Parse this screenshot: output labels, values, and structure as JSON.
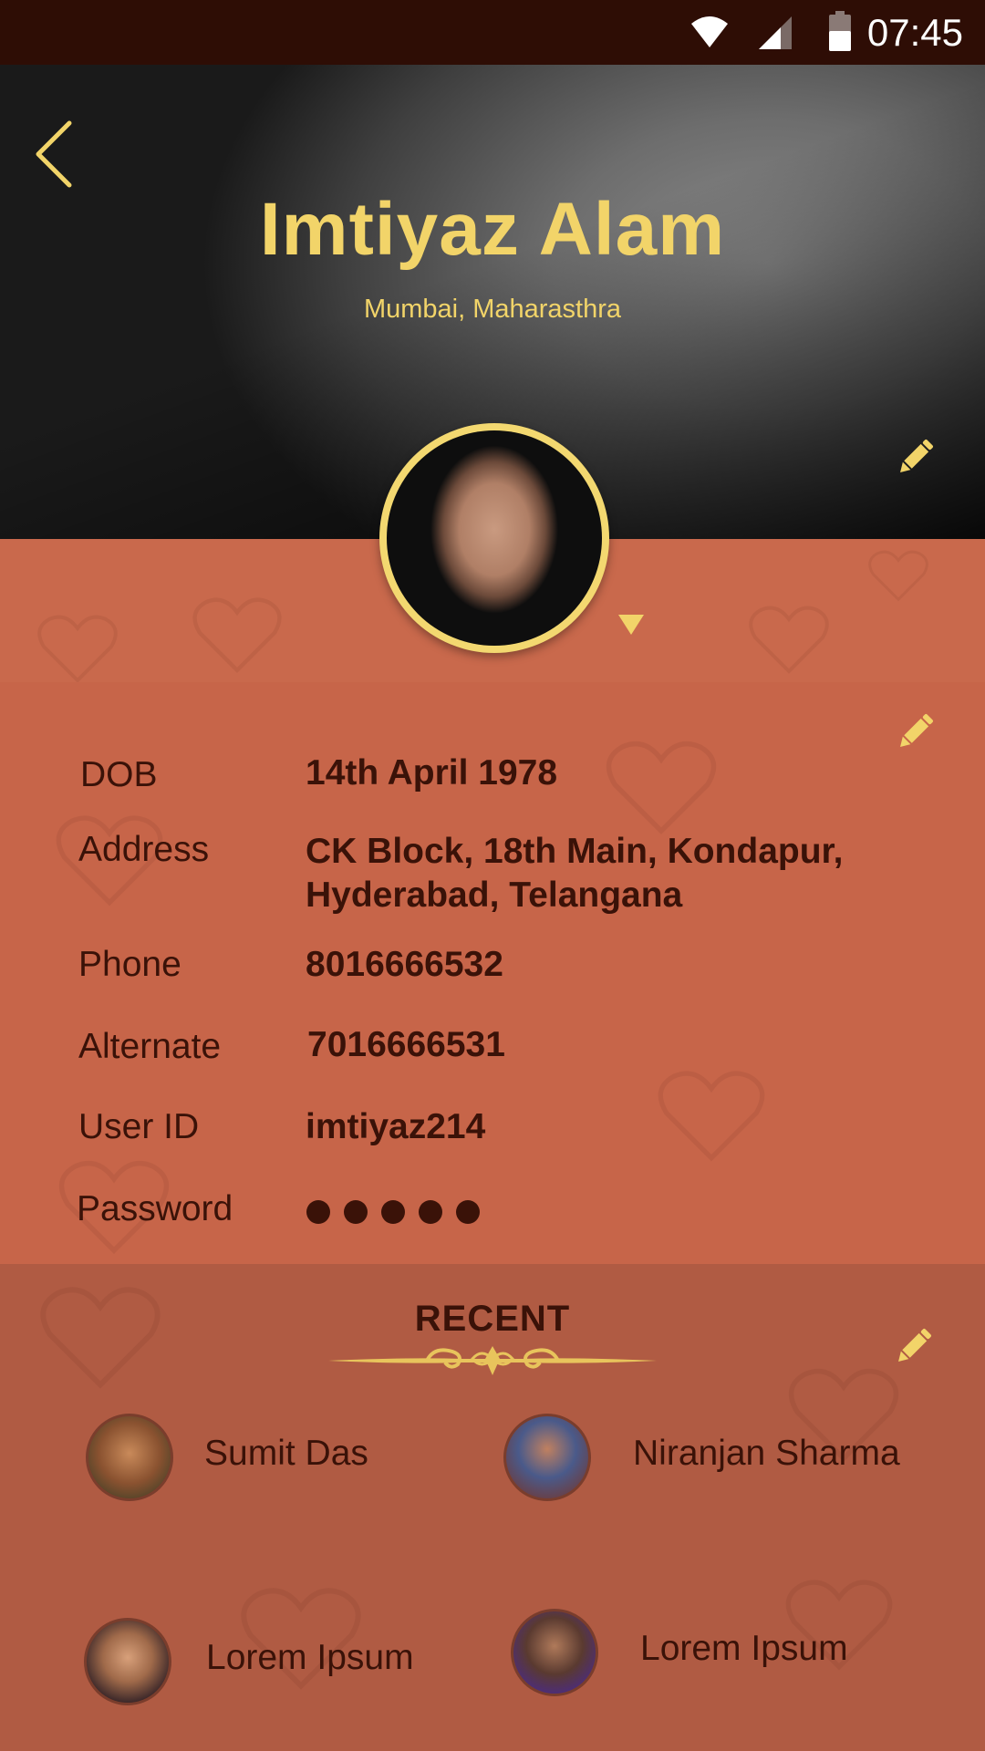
{
  "status_bar": {
    "time": "07:45",
    "icons": [
      "wifi-icon",
      "signal-icon",
      "battery-icon"
    ]
  },
  "profile": {
    "name": "Imtiyaz Alam",
    "location": "Mumbai, Maharasthra"
  },
  "details": {
    "rows": [
      {
        "label": "DOB",
        "value": "14th April 1978"
      },
      {
        "label": "Address",
        "value": "CK Block, 18th Main, Kondapur,",
        "value_line2": "Hyderabad, Telangana"
      },
      {
        "label": "Phone",
        "value": "8016666532"
      },
      {
        "label": "Alternate",
        "value": "7016666531"
      },
      {
        "label": "User ID",
        "value": "imtiyaz214"
      },
      {
        "label": "Password",
        "value": ""
      }
    ]
  },
  "recent": {
    "title": "RECENT",
    "contacts": [
      {
        "name": "Sumit Das"
      },
      {
        "name": "Niranjan Sharma"
      },
      {
        "name": "Lorem Ipsum"
      },
      {
        "name": "Lorem Ipsum"
      }
    ]
  },
  "colors": {
    "accent_gold": "#f2d469",
    "status_bar": "#2e0d05",
    "details_bg": "#c76549",
    "recent_bg": "#b05b43",
    "text_dark": "#3a1208"
  }
}
